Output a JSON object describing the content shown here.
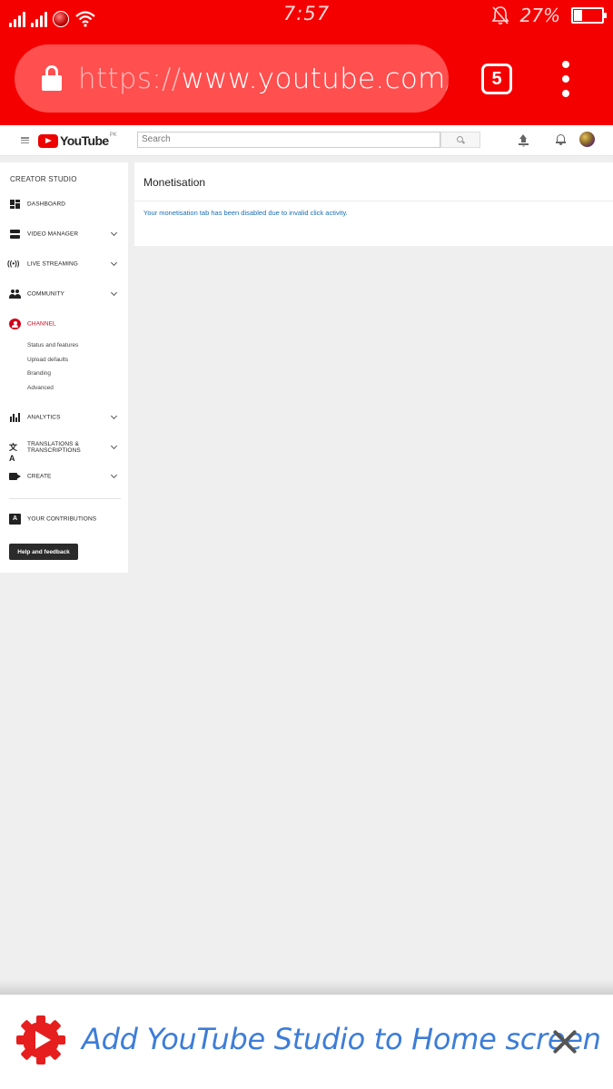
{
  "status_bar": {
    "time": "7:57",
    "battery_percent": "27%",
    "battery_level": 0.27
  },
  "browser": {
    "url_scheme": "https://",
    "url_rest": "www.youtube.com/acco",
    "tab_count": "5"
  },
  "youtube_header": {
    "logo_text": "YouTube",
    "region": "PK",
    "search_placeholder": "Search"
  },
  "sidebar": {
    "title": "CREATOR STUDIO",
    "items": [
      {
        "label": "DASHBOARD",
        "icon": "dashboard-icon",
        "expandable": false
      },
      {
        "label": "VIDEO MANAGER",
        "icon": "video-manager-icon",
        "expandable": true
      },
      {
        "label": "LIVE STREAMING",
        "icon": "live-streaming-icon",
        "expandable": true
      },
      {
        "label": "COMMUNITY",
        "icon": "community-icon",
        "expandable": true
      },
      {
        "label": "CHANNEL",
        "icon": "channel-icon",
        "expandable": false,
        "active": true
      },
      {
        "label": "ANALYTICS",
        "icon": "analytics-icon",
        "expandable": true
      },
      {
        "label_line1": "TRANSLATIONS &",
        "label_line2": "TRANSCRIPTIONS",
        "icon": "translate-icon",
        "expandable": true
      },
      {
        "label": "CREATE",
        "icon": "create-icon",
        "expandable": true
      },
      {
        "label": "YOUR CONTRIBUTIONS",
        "icon": "contributions-icon",
        "expandable": false
      }
    ],
    "channel_subitems": [
      "Status and features",
      "Upload defaults",
      "Branding",
      "Advanced"
    ],
    "help_button": "Help and feedback",
    "active_color": "#d0021b"
  },
  "main": {
    "title": "Monetisation",
    "message": "Your monetisation tab has been disabled due to invalid click activity.",
    "message_color": "#1a6db6"
  },
  "banner": {
    "text": "Add YouTube Studio to Home screen",
    "icon": "youtube-studio-icon",
    "text_color": "#3d7dd8"
  },
  "colors": {
    "browser_bar": "#f40000",
    "youtube_red": "#e00000"
  }
}
